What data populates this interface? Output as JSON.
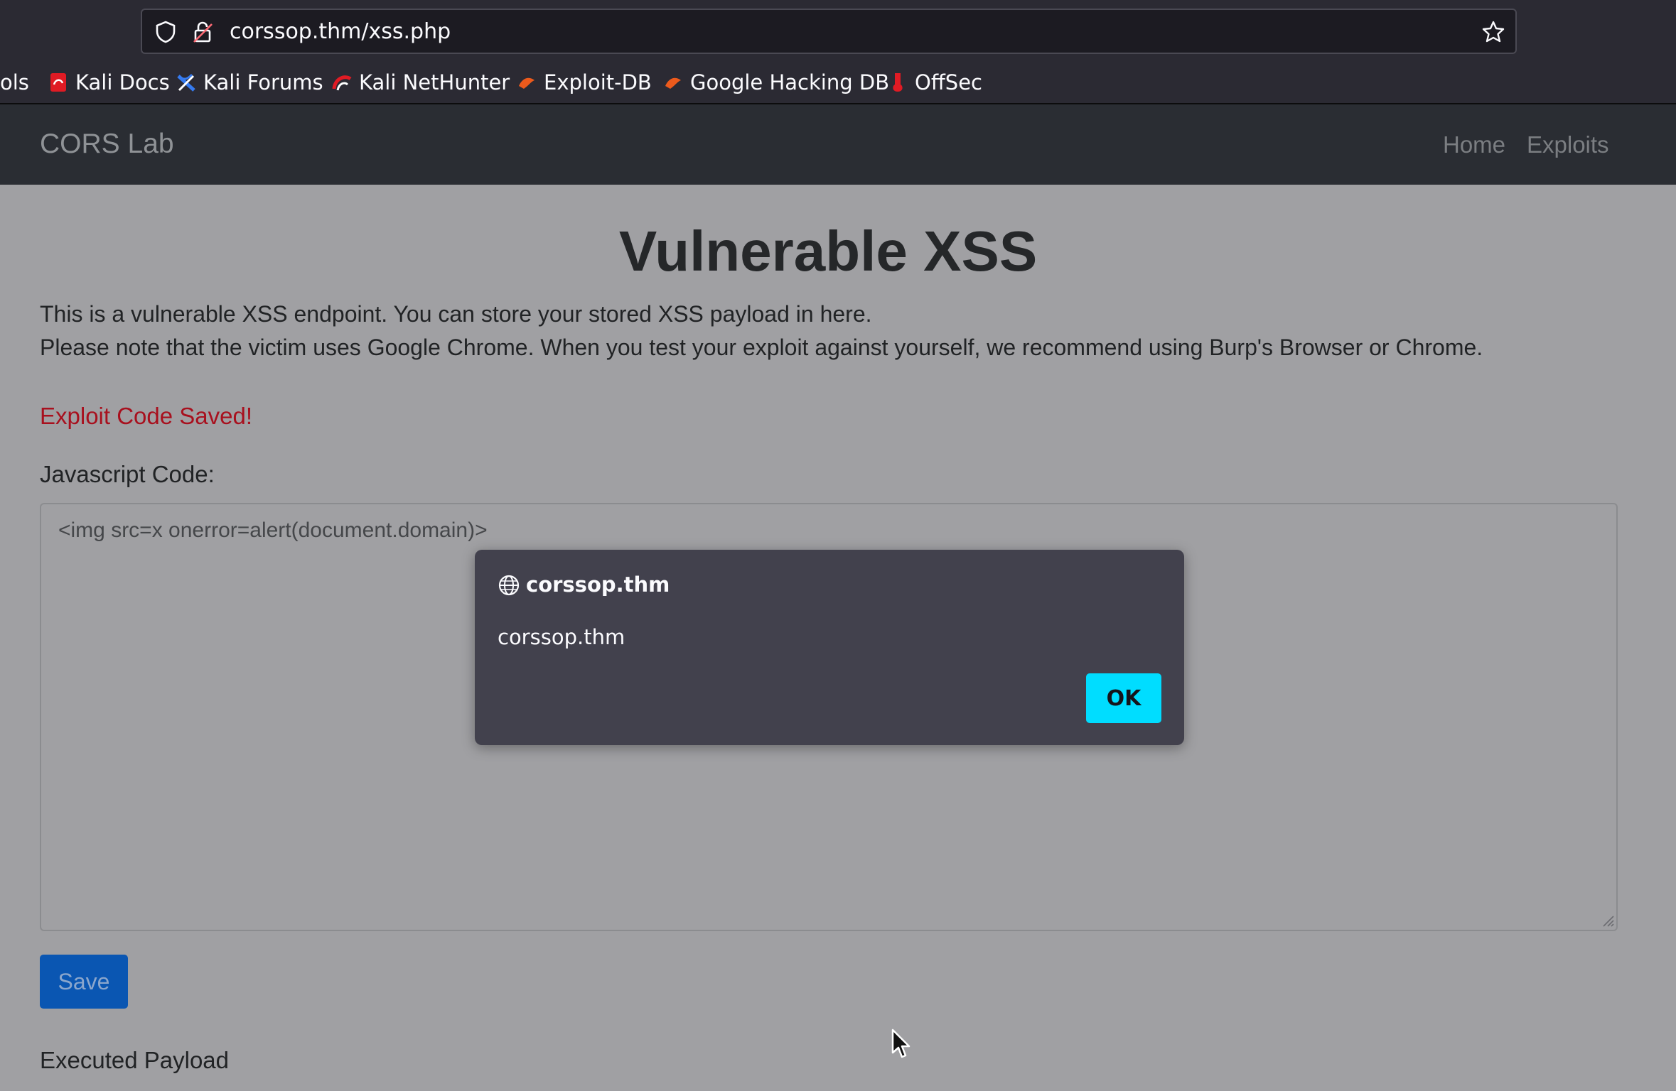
{
  "browser": {
    "url": "corssop.thm/xss.php",
    "bookmarks": [
      {
        "label": "ols",
        "icon": "none"
      },
      {
        "label": "Kali Docs",
        "icon": "kali-docs-icon"
      },
      {
        "label": "Kali Forums",
        "icon": "kali-forums-icon"
      },
      {
        "label": "Kali NetHunter",
        "icon": "kali-nethunter-icon"
      },
      {
        "label": "Exploit-DB",
        "icon": "exploit-db-icon"
      },
      {
        "label": "Google Hacking DB",
        "icon": "ghdb-icon"
      },
      {
        "label": "OffSec",
        "icon": "offsec-icon"
      }
    ]
  },
  "navbar": {
    "brand": "CORS Lab",
    "links": [
      "Home",
      "Exploits"
    ]
  },
  "main": {
    "title": "Vulnerable XSS",
    "description_line1": "This is a vulnerable XSS endpoint. You can store your stored XSS payload in here.",
    "description_line2": "Please note that the victim uses Google Chrome. When you test your exploit against yourself, we recommend using Burp's Browser or Chrome.",
    "status": "Exploit Code Saved!",
    "code_label": "Javascript Code:",
    "code_value": "<img src=x onerror=alert(document.domain)>",
    "save_label": "Save",
    "executed_label": "Executed Payload"
  },
  "alert": {
    "origin": "corssop.thm",
    "message": "corssop.thm",
    "ok_label": "OK"
  },
  "colors": {
    "accent_ok": "#00ddff",
    "status_red": "#a8101e",
    "save_blue": "#0a56b2"
  }
}
